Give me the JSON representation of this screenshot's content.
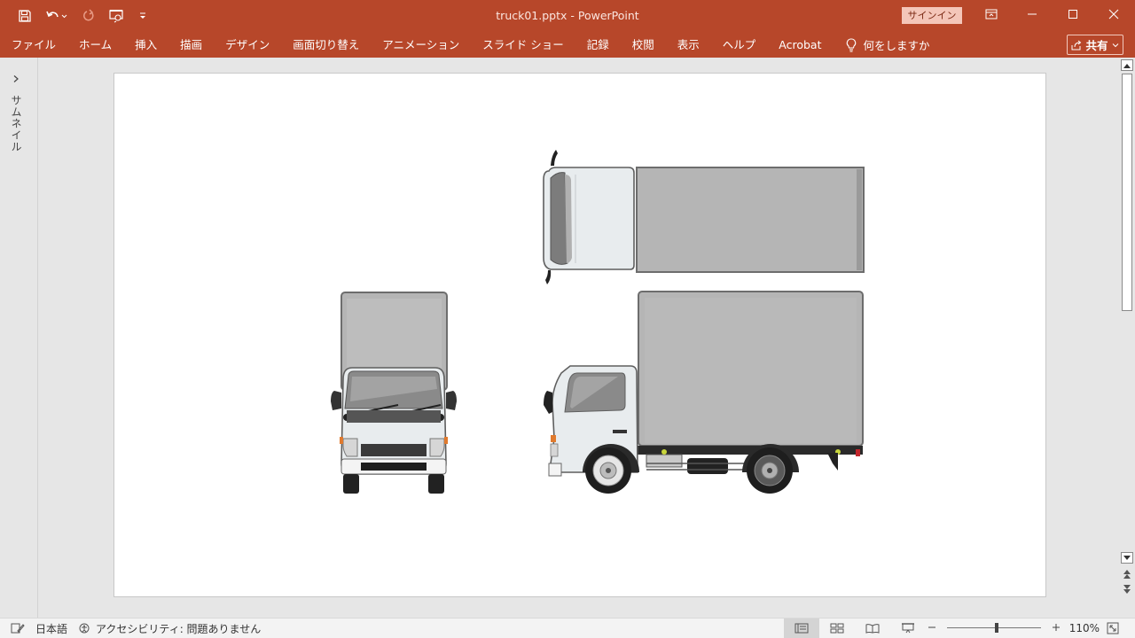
{
  "window": {
    "document_title": "truck01.pptx  -  PowerPoint",
    "signin_label": "サインイン"
  },
  "quick_access": {
    "icons": [
      "save-icon",
      "undo-icon",
      "redo-icon",
      "present-from-start-icon",
      "customize-qat-icon"
    ]
  },
  "ribbon": {
    "tabs": [
      "ファイル",
      "ホーム",
      "挿入",
      "描画",
      "デザイン",
      "画面切り替え",
      "アニメーション",
      "スライド ショー",
      "記録",
      "校閲",
      "表示",
      "ヘルプ",
      "Acrobat"
    ],
    "tell_me": "何をしますか",
    "share_label": "共有"
  },
  "thumbnails": {
    "collapsed_label": "サムネイル"
  },
  "statusbar": {
    "language": "日本語",
    "accessibility": "アクセシビリティ: 問題ありません",
    "zoom_percent": "110%",
    "zoom_fraction": 0.53
  },
  "colors": {
    "accent": "#b7472a",
    "truck_box": "#b5b5b5",
    "truck_cab": "#e8ecee"
  }
}
